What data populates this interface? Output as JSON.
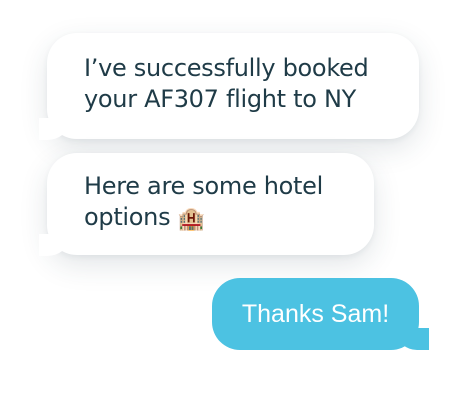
{
  "messages": [
    {
      "sender": "assistant",
      "text": "I’ve successfully booked your AF307 flight to NY"
    },
    {
      "sender": "assistant",
      "text": "Here are some hotel options",
      "emoji": "🏨",
      "icon": "hotel-icon"
    },
    {
      "sender": "user",
      "text": "Thanks Sam!"
    }
  ],
  "colors": {
    "incoming_bg": "#ffffff",
    "incoming_text": "#1f3b47",
    "outgoing_bg": "#4cc2e2",
    "outgoing_text": "#ffffff"
  }
}
